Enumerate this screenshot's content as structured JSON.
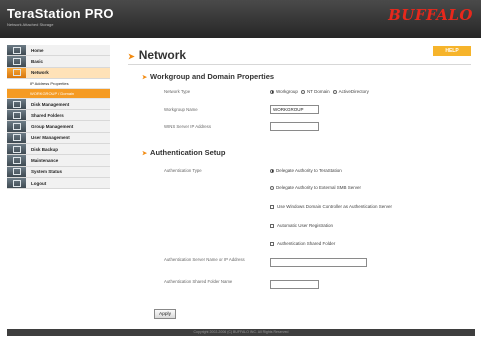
{
  "header": {
    "brand": "TeraStation PRO",
    "tagline": "Network Attached Storage",
    "logo": "BUFFALO"
  },
  "sidebar": {
    "items": [
      {
        "label": "Home",
        "icon": "home-icon"
      },
      {
        "label": "Basic",
        "icon": "basic-icon"
      },
      {
        "label": "Network",
        "icon": "network-icon",
        "active": true
      },
      {
        "label": "IP Address Properties",
        "sub": true
      },
      {
        "label": "WORKGROUP / Domain",
        "sub": true,
        "active": true
      },
      {
        "label": "Disk Management",
        "icon": "disk-icon"
      },
      {
        "label": "Shared Folders",
        "icon": "folder-icon"
      },
      {
        "label": "Group Management",
        "icon": "group-icon"
      },
      {
        "label": "User Management",
        "icon": "user-icon"
      },
      {
        "label": "Disk Backup",
        "icon": "backup-icon"
      },
      {
        "label": "Maintenance",
        "icon": "maintenance-icon"
      },
      {
        "label": "System Status",
        "icon": "status-icon"
      },
      {
        "label": "Logout",
        "icon": "logout-icon"
      }
    ]
  },
  "main": {
    "title": "Network",
    "help": "HELP",
    "workgroup": {
      "title": "Workgroup and Domain Properties",
      "network_type_label": "Network Type",
      "options": [
        "Workgroup",
        "NT Domain",
        "ActiveDirectory"
      ],
      "workgroup_name_label": "Workgroup Name",
      "workgroup_name_value": "WORKGROUP",
      "wins_label": "WINS Server IP Address",
      "wins_value": ""
    },
    "auth": {
      "title": "Authentication Setup",
      "type_label": "Authentication Type",
      "opt_delegate_ts": "Delegate Authority to TeraStation",
      "opt_delegate_smb": "Delegate Authority to External SMB Server",
      "chk_windows_dc": "Use Windows Domain Controller as Authentication Server",
      "chk_auto_reg": "Automatic User Registration",
      "chk_shared_folder": "Authentication Shared Folder",
      "server_label": "Authentication Server Name or IP Address",
      "server_value": "",
      "folder_label": "Authentication Shared Folder Name",
      "folder_value": ""
    },
    "apply": "Apply"
  },
  "footer": {
    "copyright": "Copyright 2002-2006 (C) BUFFALO INC. All Rights Reserved"
  }
}
